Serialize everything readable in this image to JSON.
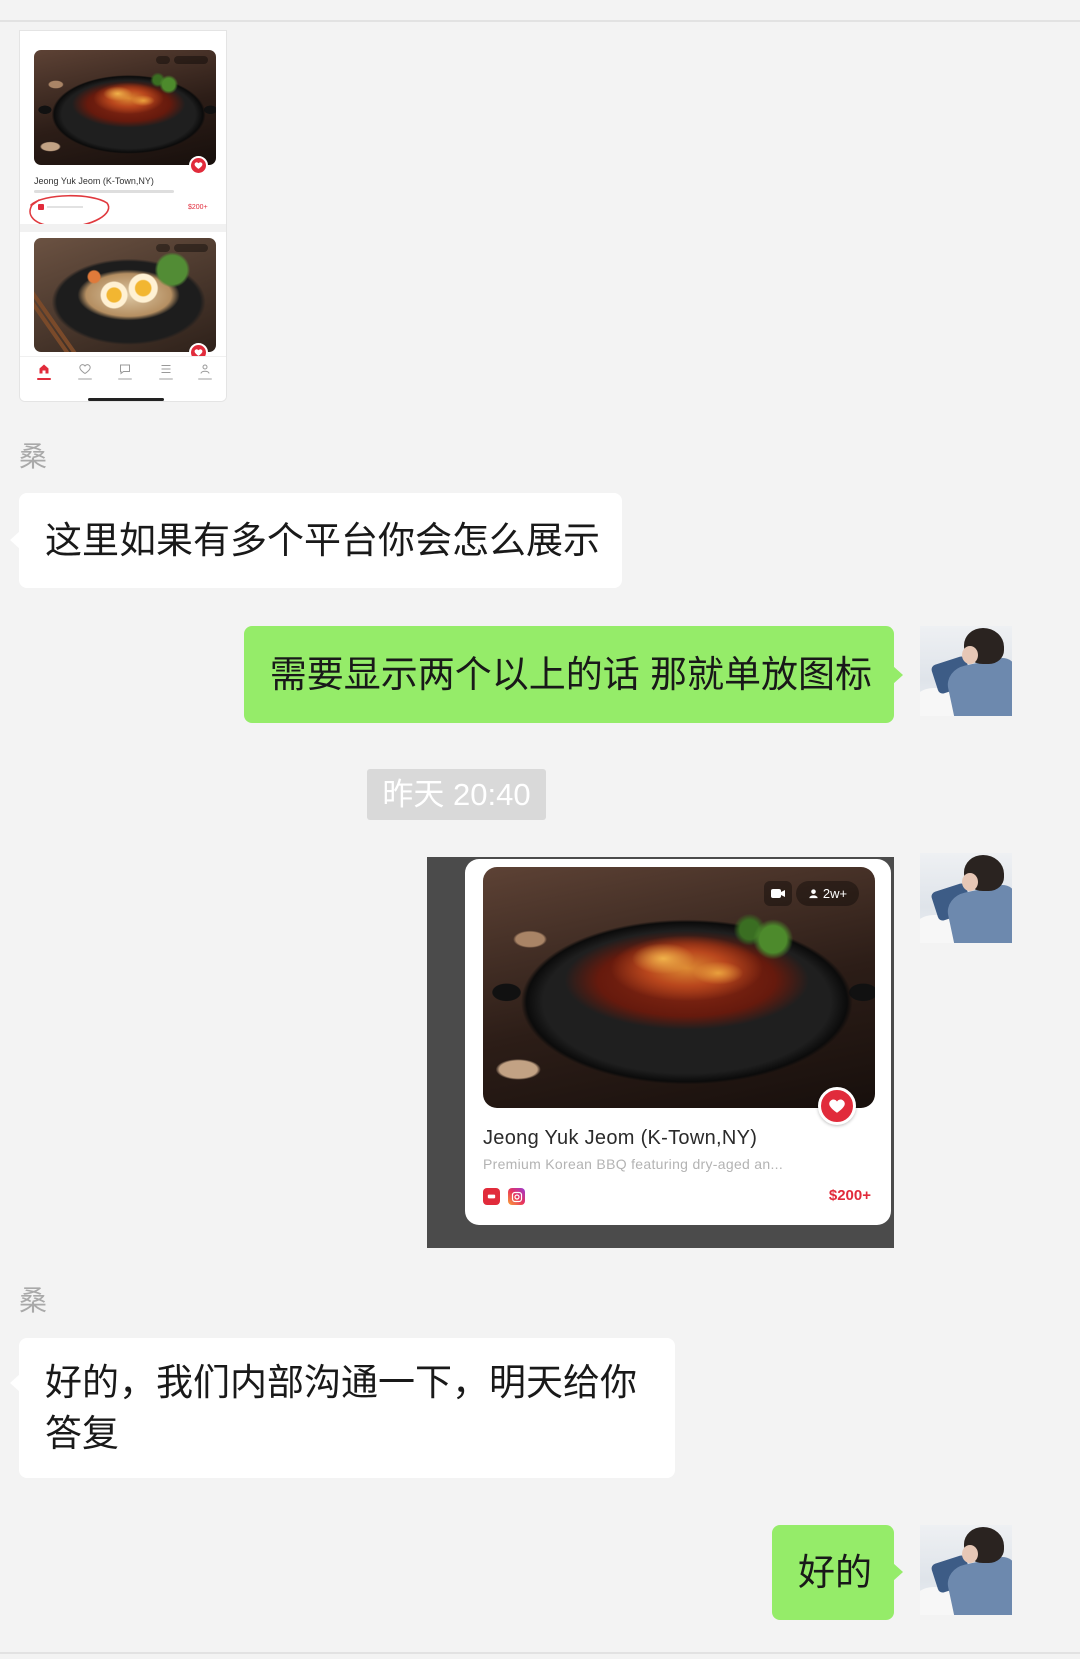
{
  "colors": {
    "background": "#f3f3f3",
    "bubble_incoming": "#ffffff",
    "bubble_outgoing": "#95ec69",
    "accent": "#e12b3b",
    "timestamp_bg": "#d9d9d9"
  },
  "messages": {
    "incoming_1": {
      "sender": "桑",
      "text": "这里如果有多个平台你会怎么展示"
    },
    "outgoing_1": {
      "text": "需要显示两个以上的话 那就单放图标"
    },
    "timestamp_1": {
      "text": "昨天 20:40"
    },
    "incoming_2": {
      "sender": "桑",
      "text": "好的，我们内部沟通一下，明天给你答复"
    },
    "outgoing_2": {
      "text": "好的"
    }
  },
  "thumbnail": {
    "title": "Jeong Yuk Jeom (K-Town,NY)",
    "price": "$200+",
    "tab_icons": [
      "home-icon",
      "heart-icon",
      "chat-icon",
      "list-icon",
      "user-icon"
    ]
  },
  "restaurant_card": {
    "stats_badge": "2w+",
    "title": "Jeong Yuk Jeom (K-Town,NY)",
    "description": "Premium Korean BBQ featuring dry-aged an...",
    "price": "$200+",
    "platform_icons": [
      "red-platform-icon",
      "instagram-icon"
    ],
    "favorite_icon": "heart-icon"
  }
}
